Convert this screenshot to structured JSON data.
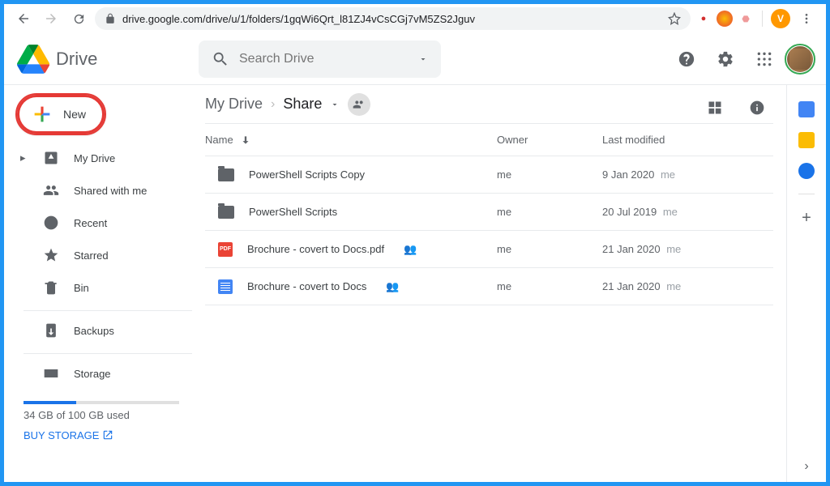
{
  "browser": {
    "url": "drive.google.com/drive/u/1/folders/1gqWi6Qrt_l81ZJ4vCsCGj7vM5ZS2Jguv",
    "profile_initial": "V"
  },
  "header": {
    "app_name": "Drive",
    "search_placeholder": "Search Drive"
  },
  "sidebar": {
    "new_button": "New",
    "items": [
      {
        "label": "My Drive",
        "icon": "mydrive"
      },
      {
        "label": "Shared with me",
        "icon": "shared"
      },
      {
        "label": "Recent",
        "icon": "recent"
      },
      {
        "label": "Starred",
        "icon": "starred"
      },
      {
        "label": "Bin",
        "icon": "bin"
      }
    ],
    "backups": "Backups",
    "storage_label": "Storage",
    "storage_text": "34 GB of 100 GB used",
    "storage_percent": 34,
    "buy_storage": "BUY STORAGE"
  },
  "breadcrumb": {
    "root": "My Drive",
    "current": "Share"
  },
  "columns": {
    "name": "Name",
    "owner": "Owner",
    "modified": "Last modified"
  },
  "files": [
    {
      "type": "folder",
      "name": "PowerShell Scripts Copy",
      "owner": "me",
      "modified": "9 Jan 2020",
      "modby": "me",
      "shared": false
    },
    {
      "type": "folder",
      "name": "PowerShell Scripts",
      "owner": "me",
      "modified": "20 Jul 2019",
      "modby": "me",
      "shared": false
    },
    {
      "type": "pdf",
      "name": "Brochure - covert to Docs.pdf",
      "owner": "me",
      "modified": "21 Jan 2020",
      "modby": "me",
      "shared": true
    },
    {
      "type": "doc",
      "name": "Brochure - covert to Docs",
      "owner": "me",
      "modified": "21 Jan 2020",
      "modby": "me",
      "shared": true
    }
  ]
}
